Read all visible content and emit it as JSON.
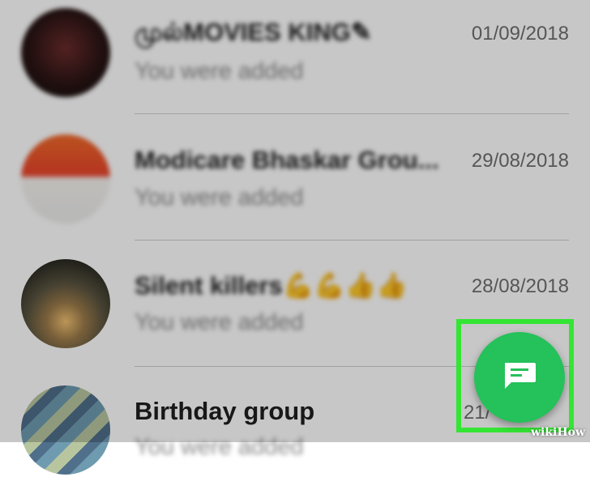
{
  "chats": [
    {
      "name": "முல்MOVIES KING✎",
      "subtitle": "You were added",
      "date": "01/09/2018"
    },
    {
      "name": "Modicare  Bhaskar Grou...",
      "subtitle": "You were added",
      "date": "29/08/2018"
    },
    {
      "name": "Silent killers💪💪👍👍",
      "subtitle": "You were added",
      "date": "28/08/2018"
    },
    {
      "name": "Birthday group",
      "subtitle": "You were added",
      "date": "21/"
    }
  ],
  "fab": {
    "icon": "new-chat-icon",
    "color": "#25c15a"
  },
  "highlight_color": "#34e534",
  "watermark": "wikiHow"
}
